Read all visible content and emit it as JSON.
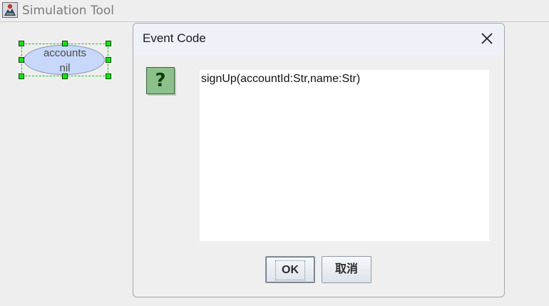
{
  "window": {
    "title": "Simulation Tool"
  },
  "canvas": {
    "node": {
      "name": "accounts",
      "value": "nil"
    }
  },
  "dialog": {
    "title": "Event Code",
    "code": "signUp(accountId:Str,name:Str)",
    "ok_label": "OK",
    "cancel_label": "取消"
  },
  "icons": {
    "app": "app-icon",
    "close": "close-icon",
    "question": "question-icon",
    "question_glyph": "?"
  },
  "colors": {
    "node_fill": "#c7d8fb",
    "selection": "#18e018",
    "question_bg": "#8cc08c"
  }
}
